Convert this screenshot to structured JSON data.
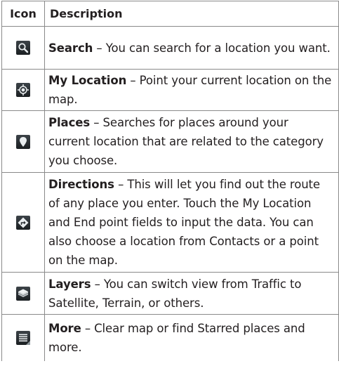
{
  "table": {
    "headers": {
      "icon": "Icon",
      "description": "Description"
    },
    "rows": [
      {
        "icon": "search-icon",
        "term": "Search",
        "text": " – You can search for a location you want."
      },
      {
        "icon": "my-location-icon",
        "term": "My Location",
        "text": " – Point your current location on the map."
      },
      {
        "icon": "places-pin-icon",
        "term": "Places",
        "text": " – Searches for places around your current location that are related to the category you choose."
      },
      {
        "icon": "directions-icon",
        "term": "Directions",
        "text": " – This will let you find out the route of any place you enter. Touch the My Location and End point fields to input the data. You can also choose a location from Contacts or a point on the map."
      },
      {
        "icon": "layers-icon",
        "term": "Layers",
        "text": " – You can switch view from Traffic to Satellite, Terrain, or others."
      },
      {
        "icon": "more-menu-icon",
        "term": "More",
        "text": " – Clear map or find Starred places and more."
      }
    ]
  }
}
